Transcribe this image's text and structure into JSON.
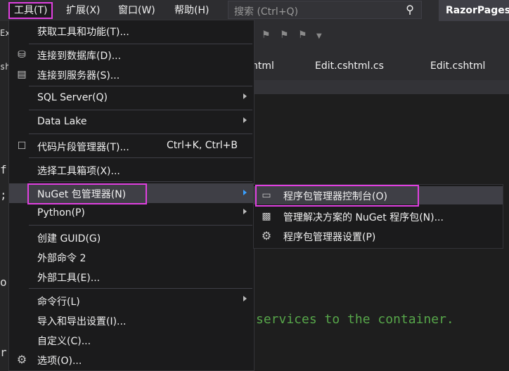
{
  "menubar": {
    "items": [
      {
        "label": "工具(T)",
        "active": true
      },
      {
        "label": "扩展(X)"
      },
      {
        "label": "窗口(W)"
      },
      {
        "label": "帮助(H)"
      }
    ],
    "search_placeholder": "搜索 (Ctrl+Q)",
    "project_title": "RazorPagesM"
  },
  "tabs": [
    "html",
    "Edit.cshtml.cs",
    "Edit.cshtml"
  ],
  "left_edge_chars": [
    "Ex",
    "sh",
    "f",
    ";",
    "o",
    "r"
  ],
  "code_line": "services to the container.",
  "tools_menu": {
    "items": [
      {
        "label": "获取工具和功能(T)..."
      },
      {
        "label": "连接到数据库(D)..."
      },
      {
        "label": "连接到服务器(S)..."
      },
      {
        "label": "SQL Server(Q)"
      },
      {
        "label": "Data Lake"
      },
      {
        "label": "代码片段管理器(T)...",
        "shortcut": "Ctrl+K, Ctrl+B"
      },
      {
        "label": "选择工具箱项(X)..."
      },
      {
        "label": "NuGet 包管理器(N)"
      },
      {
        "label": "Python(P)"
      },
      {
        "label": "创建 GUID(G)"
      },
      {
        "label": "外部命令 2"
      },
      {
        "label": "外部工具(E)..."
      },
      {
        "label": "命令行(L)"
      },
      {
        "label": "导入和导出设置(I)..."
      },
      {
        "label": "自定义(C)..."
      },
      {
        "label": "选项(O)..."
      }
    ]
  },
  "nuget_menu": {
    "items": [
      {
        "label": "程序包管理器控制台(O)"
      },
      {
        "label": "管理解决方案的 NuGet 程序包(N)..."
      },
      {
        "label": "程序包管理器设置(P)"
      }
    ]
  },
  "colors": {
    "highlight_outline": "#e040e0",
    "menu_bg": "#1b1b1c",
    "hover_bg": "#3f3f46",
    "comment_green": "#57a64a"
  }
}
